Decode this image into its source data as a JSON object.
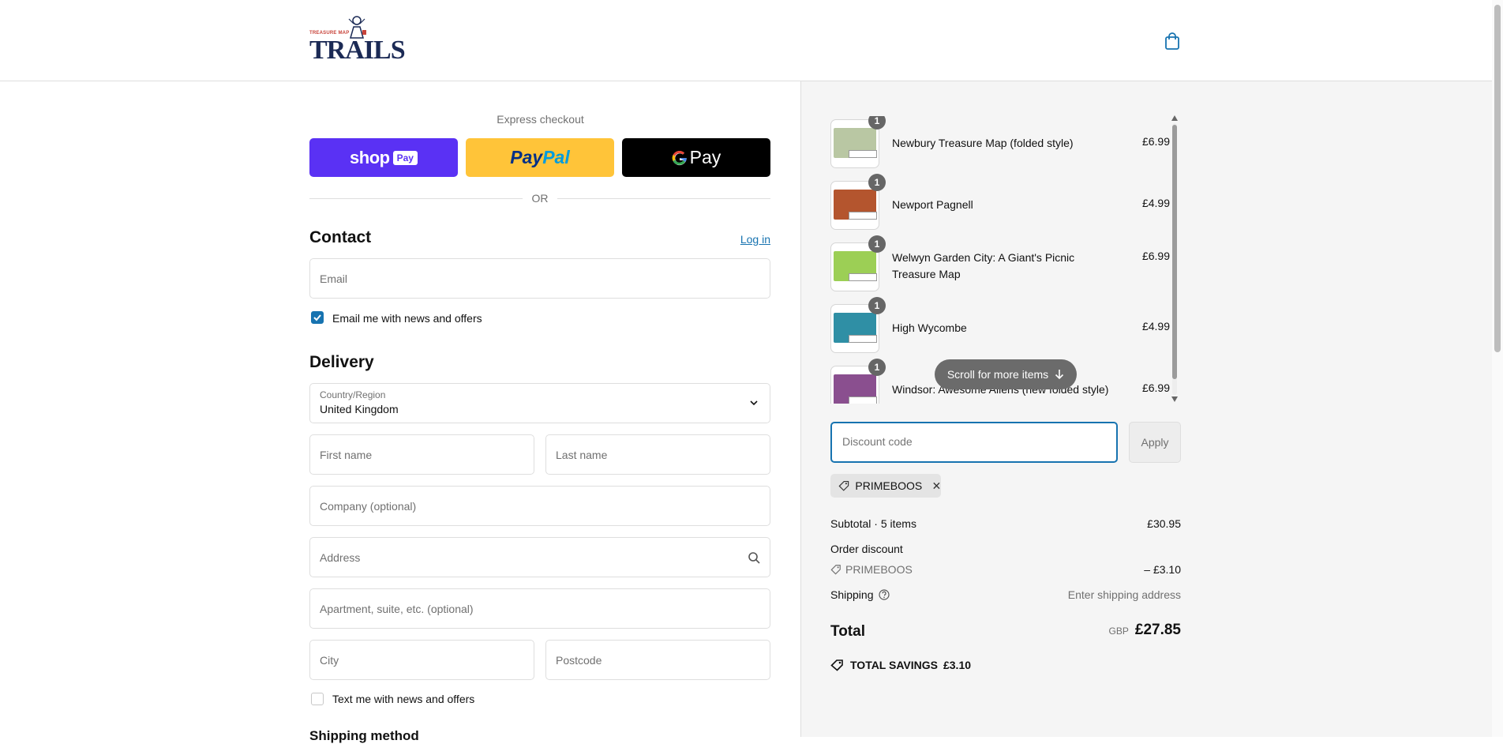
{
  "header": {
    "logo_tiny": "TREASURE MAP",
    "logo_main": "TRAILS"
  },
  "express": {
    "label": "Express checkout",
    "shop_text": "shop",
    "shop_pay": "Pay",
    "paypal_1": "Pay",
    "paypal_2": "Pal",
    "gpay_g": "G",
    "gpay_text": "Pay",
    "or": "OR"
  },
  "contact": {
    "title": "Contact",
    "login": "Log in",
    "email_placeholder": "Email",
    "email_news_label": "Email me with news and offers",
    "email_news_checked": true
  },
  "delivery": {
    "title": "Delivery",
    "country_label": "Country/Region",
    "country_value": "United Kingdom",
    "first_name": "First name",
    "last_name": "Last name",
    "company": "Company (optional)",
    "address": "Address",
    "apartment": "Apartment, suite, etc. (optional)",
    "city": "City",
    "postcode": "Postcode",
    "text_news_label": "Text me with news and offers",
    "text_news_checked": false,
    "shipping_method": "Shipping method"
  },
  "cart": {
    "items": [
      {
        "name": "Newbury Treasure Map (folded style)",
        "price": "£6.99",
        "qty": "1",
        "color": "#b9c7a3"
      },
      {
        "name": "Newport Pagnell",
        "price": "£4.99",
        "qty": "1",
        "color": "#b4552e"
      },
      {
        "name": "Welwyn Garden City: A Giant's Picnic Treasure Map",
        "price": "£6.99",
        "qty": "1",
        "color": "#9ccf55"
      },
      {
        "name": "High Wycombe",
        "price": "£4.99",
        "qty": "1",
        "color": "#2f8fa5"
      },
      {
        "name": "Windsor: Awesome Aliens (new folded style)",
        "price": "£6.99",
        "qty": "1",
        "color": "#8a4f8f"
      }
    ],
    "scroll_hint": "Scroll for more items"
  },
  "discount": {
    "placeholder": "Discount code",
    "apply": "Apply",
    "applied_code": "PRIMEBOOS"
  },
  "summary": {
    "subtotal_label": "Subtotal · 5 items",
    "subtotal_value": "£30.95",
    "order_discount_label": "Order discount",
    "discount_code": "PRIMEBOOS",
    "discount_value": "– £3.10",
    "shipping_label": "Shipping",
    "shipping_value": "Enter shipping address",
    "total_label": "Total",
    "currency": "GBP",
    "total_value": "£27.85",
    "savings_label": "TOTAL SAVINGS",
    "savings_value": "£3.10"
  },
  "colors": {
    "accent": "#1773b0",
    "shop_pay": "#5a31f4",
    "paypal": "#ffc439"
  }
}
